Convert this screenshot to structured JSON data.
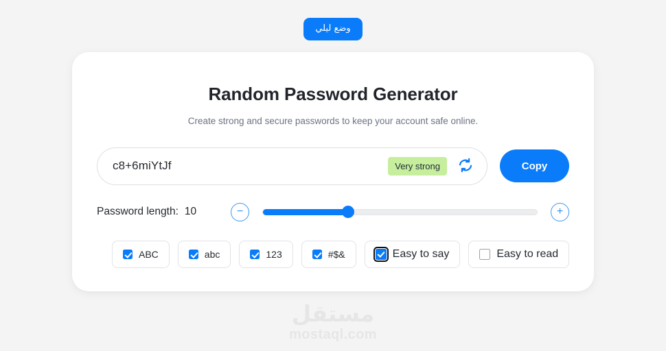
{
  "theme": {
    "accent": "#0a7cfa",
    "page_background": "#f4f4f5",
    "card_background": "#ffffff",
    "strength_badge_background": "#c6ee9c",
    "text_primary": "#24292f",
    "text_muted": "#6b7280"
  },
  "night_mode": {
    "label": "وضع ليلي"
  },
  "header": {
    "title": "Random Password Generator",
    "subtitle": "Create strong and secure passwords to keep your account safe online."
  },
  "password_field": {
    "value": "c8+6miYtJf",
    "placeholder": "",
    "strength_label": "Very strong",
    "refresh_icon": "refresh-icon"
  },
  "copy_button": {
    "label": "Copy"
  },
  "length": {
    "label": "Password length:",
    "value": "10",
    "min": 4,
    "max": 24,
    "percent": 31,
    "decrease_label": "−",
    "increase_label": "+"
  },
  "options": [
    {
      "id": "uppercase",
      "label": "ABC",
      "checked": true,
      "focused": false,
      "big": false
    },
    {
      "id": "lowercase",
      "label": "abc",
      "checked": true,
      "focused": false,
      "big": false
    },
    {
      "id": "numbers",
      "label": "123",
      "checked": true,
      "focused": false,
      "big": false
    },
    {
      "id": "symbols",
      "label": "#$&",
      "checked": true,
      "focused": false,
      "big": false
    },
    {
      "id": "easy-to-say",
      "label": "Easy to say",
      "checked": true,
      "focused": true,
      "big": true
    },
    {
      "id": "easy-to-read",
      "label": "Easy to read",
      "checked": false,
      "focused": false,
      "big": true
    }
  ],
  "watermark": {
    "arabic": "مستقل",
    "latin": "mostaql.com"
  }
}
